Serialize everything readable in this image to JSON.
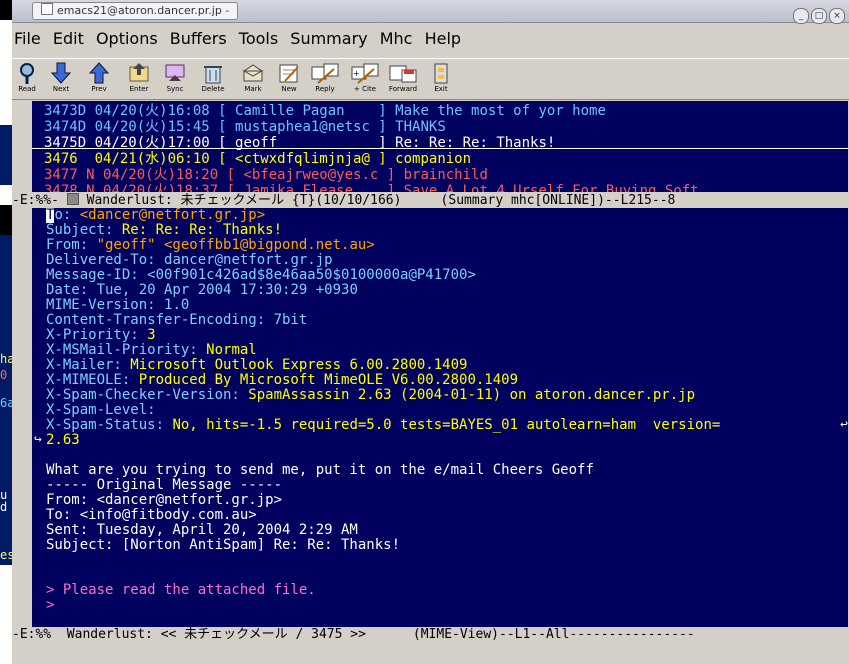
{
  "window": {
    "title": "emacs21@atoron.dancer.pr.jp -",
    "buttons": [
      "_",
      "□",
      "×"
    ]
  },
  "menu": [
    "File",
    "Edit",
    "Options",
    "Buffers",
    "Tools",
    "Summary",
    "Mhc",
    "Help"
  ],
  "toolbar": [
    {
      "label": "Read",
      "icon": "magnifier-icon"
    },
    {
      "label": "Next",
      "icon": "arrow-down-icon"
    },
    {
      "label": "Prev",
      "icon": "arrow-up-icon"
    },
    {
      "label": "Enter",
      "icon": "enter-folder-icon"
    },
    {
      "label": "Sync",
      "icon": "sync-icon"
    },
    {
      "label": "Delete",
      "icon": "delete-icon"
    },
    {
      "label": "Mark",
      "icon": "mark-icon"
    },
    {
      "label": "New",
      "icon": "new-message-icon"
    },
    {
      "label": "Reply",
      "icon": "reply-icon"
    },
    {
      "label": "+ Cite",
      "icon": "cite-icon"
    },
    {
      "label": "Forward",
      "icon": "forward-icon"
    },
    {
      "label": "Exit",
      "icon": "exit-icon"
    }
  ],
  "summary": {
    "rows": [
      {
        "num": "3473D",
        "date": "04/20(火)16:08",
        "from": "[ Camille Pagan    ]",
        "subject": "Make the most of yor home",
        "style": ""
      },
      {
        "num": "3474D",
        "date": "04/20(火)15:45",
        "from": "[ mustaphea1@netsc ]",
        "subject": "THANKS",
        "style": ""
      },
      {
        "num": "3475D",
        "date": "04/20(火)17:00",
        "from": "[ geoff            ]",
        "subject": "Re: Re: Re: Thanks!",
        "style": "current"
      },
      {
        "num": "3476 ",
        "date": "04/21(水)06:10",
        "from": "[ <ctwxdfqlimjnja@ ]",
        "subject": "companion",
        "style": "yellow"
      },
      {
        "num": "3477 N",
        "date": "04/20(火)18:20",
        "from": "[ <bfeajrweo@yes.c ]",
        "subject": "brainchild",
        "style": "red"
      },
      {
        "num": "3478 N",
        "date": "04/20(火)18:37",
        "from": "[ Jamika Flease    ]",
        "subject": "Save A Lot 4 Urself For Buying Soft",
        "style": "red"
      }
    ],
    "modeline": {
      "prefix": "-E:%%- ",
      "text": " Wanderlust: 未チェックメール {T}(10/10/166)     (Summary mhc[ONLINE])--L215--8"
    }
  },
  "message": {
    "headers": [
      {
        "label": "To: ",
        "value": "<dancer@netfort.gr.jp>",
        "color": "orange"
      },
      {
        "label": "Subject: ",
        "value": "Re: Re: Re: Thanks!",
        "color": "yellow"
      },
      {
        "label": "From: ",
        "value": "\"geoff\" <geoffbb1@bigpond.net.au>",
        "color": "orange"
      },
      {
        "label": "Delivered-To: ",
        "value": "dancer@netfort.gr.jp",
        "color": "cyan"
      },
      {
        "label": "Message-ID: ",
        "value": "<00f901c426ad$8e46aa50$0100000a@P41700>",
        "color": "cyan"
      },
      {
        "label": "Date: ",
        "value": "Tue, 20 Apr 2004 17:30:29 +0930",
        "color": "cyan"
      },
      {
        "label": "MIME-Version: ",
        "value": "1.0",
        "color": "cyan"
      },
      {
        "label": "Content-Transfer-Encoding: ",
        "value": "7bit",
        "color": "cyan"
      },
      {
        "label": "X-Priority: ",
        "value": "3",
        "color": "yellow"
      },
      {
        "label": "X-MSMail-Priority: ",
        "value": "Normal",
        "color": "yellow"
      },
      {
        "label": "X-Mailer: ",
        "value": "Microsoft Outlook Express 6.00.2800.1409",
        "color": "yellow"
      },
      {
        "label": "X-MIMEOLE: ",
        "value": "Produced By Microsoft MimeOLE V6.00.2800.1409",
        "color": "yellow"
      },
      {
        "label": "X-Spam-Checker-Version: ",
        "value": "SpamAssassin 2.63 (2004-01-11) on atoron.dancer.pr.jp",
        "color": "yellow"
      },
      {
        "label": "X-Spam-Level: ",
        "value": "",
        "color": "yellow"
      },
      {
        "label": "X-Spam-Status: ",
        "value": "No, hits=-1.5 required=5.0 tests=BAYES_01 autolearn=ham  version=",
        "color": "yellow"
      },
      {
        "label": "",
        "value": "2.63",
        "color": "yellow"
      }
    ],
    "body": [
      {
        "text": "",
        "color": "white"
      },
      {
        "text": "What are you trying to send me, put it on the e/mail Cheers Geoff",
        "color": "white"
      },
      {
        "text": "----- Original Message -----",
        "color": "white"
      },
      {
        "text": "From: <dancer@netfort.gr.jp>",
        "color": "white"
      },
      {
        "text": "To: <info@fitbody.com.au>",
        "color": "white"
      },
      {
        "text": "Sent: Tuesday, April 20, 2004 2:29 AM",
        "color": "white"
      },
      {
        "text": "Subject: [Norton AntiSpam] Re: Re: Thanks!",
        "color": "white"
      },
      {
        "text": "",
        "color": "white"
      },
      {
        "text": "",
        "color": "white"
      },
      {
        "text": "> Please read the attached file.",
        "color": "pink"
      },
      {
        "text": ">",
        "color": "pink"
      }
    ],
    "modeline": "-E:%%  Wanderlust: << 未チェックメール / 3475 >>      (MIME-View)--L1--All----------------"
  },
  "left_strip": [
    "ha",
    "0",
    "6a",
    "u",
    "es",
    "d"
  ],
  "colors": {
    "background": "#00005f",
    "label": "#7fd0ff",
    "orange": "#ffa500",
    "yellow": "#ffff00",
    "pink": "#ff6ec7",
    "red": "#ff5a5a"
  }
}
